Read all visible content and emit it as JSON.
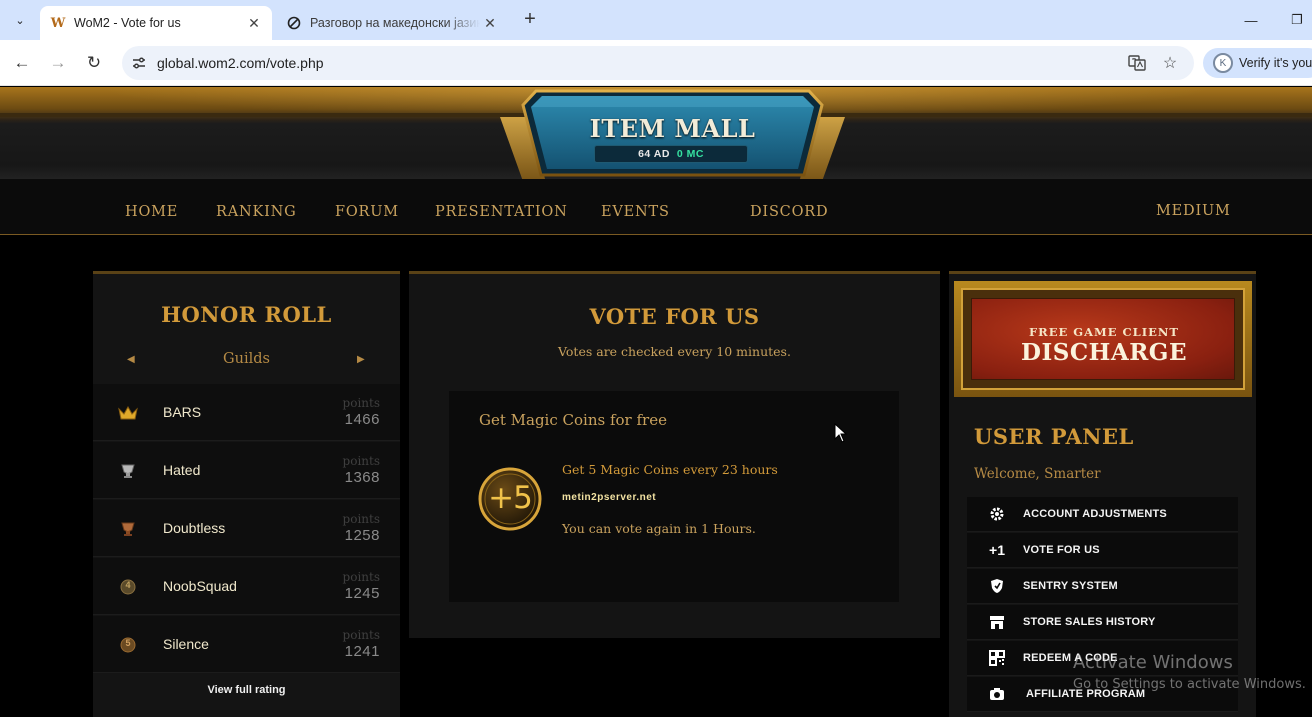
{
  "browser": {
    "tabs": [
      {
        "title": "WoM2 - Vote for us",
        "favicon": "W"
      },
      {
        "title": "Разговор на македонски јазик"
      }
    ],
    "url": "global.wom2.com/vote.php",
    "profile_label": "Verify it's you",
    "profile_initial": "K"
  },
  "header": {
    "mall_title": "ITEM MALL",
    "balance_ad": "64 AD",
    "balance_mc": "0 MC"
  },
  "nav": {
    "items": [
      "HOME",
      "RANKING",
      "FORUM",
      "PRESENTATION",
      "EVENTS",
      "DISCORD"
    ],
    "right": "MEDIUM"
  },
  "honor_roll": {
    "title": "HONOR ROLL",
    "selector": "Guilds",
    "points_label": "points",
    "rows": [
      {
        "name": "BARS",
        "points": "1466",
        "medal": "crown-icon"
      },
      {
        "name": "Hated",
        "points": "1368",
        "medal": "silver-cup-icon"
      },
      {
        "name": "Doubtless",
        "points": "1258",
        "medal": "bronze-cup-icon"
      },
      {
        "name": "NoobSquad",
        "points": "1245",
        "medal": "rank-4-icon"
      },
      {
        "name": "Silence",
        "points": "1241",
        "medal": "rank-5-icon"
      }
    ],
    "footer_link": "View full rating",
    "rank_badges": [
      "4",
      "5"
    ]
  },
  "vote": {
    "title": "VOTE FOR US",
    "subtitle": "Votes are checked every 10 minutes.",
    "box_heading": "Get Magic Coins for free",
    "coin_badge": "+5",
    "reward_line": "Get 5 Magic Coins every 23 hours",
    "site": "metin2pserver.net",
    "cooldown": "You can vote again in 1 Hours."
  },
  "user_panel": {
    "banner_sub": "FREE GAME CLIENT",
    "banner_main": "DISCHARGE",
    "title": "USER PANEL",
    "welcome": "Welcome, Smarter",
    "menu": [
      {
        "label": "ACCOUNT ADJUSTMENTS",
        "icon": "gear-icon"
      },
      {
        "label": "VOTE FOR US",
        "icon": "plus-one-icon",
        "glyph": "+1"
      },
      {
        "label": "SENTRY SYSTEM",
        "icon": "shield-icon"
      },
      {
        "label": "STORE SALES HISTORY",
        "icon": "store-icon"
      },
      {
        "label": "REDEEM A CODE",
        "icon": "qr-code-icon"
      },
      {
        "label": "AFFILIATE PROGRAM",
        "icon": "camera-icon"
      }
    ]
  },
  "watermark": {
    "line1": "Activate Windows",
    "line2": "Go to Settings to activate Windows."
  }
}
